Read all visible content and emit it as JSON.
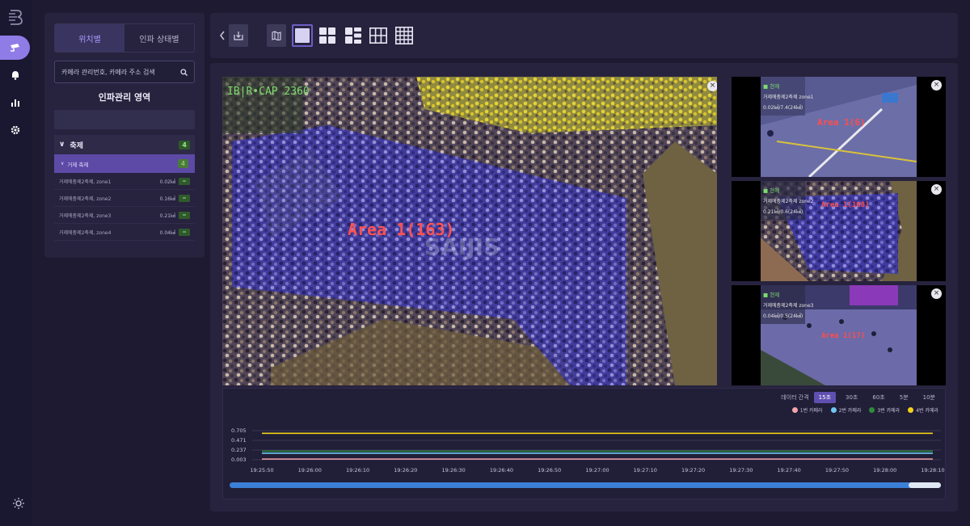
{
  "sidebar": {
    "tabs": [
      "위치별",
      "인파 상태별"
    ],
    "active_tab": 0,
    "search_placeholder": "카메라 관리번호, 카메라 주소 검색",
    "section_title": "인파관리 영역",
    "group": {
      "label": "축제",
      "count": "4"
    },
    "subgroup": {
      "label": "거제 축제",
      "count": "4"
    },
    "items": [
      {
        "name": "거제에충제2축제, zone1",
        "area": "0.02㎢"
      },
      {
        "name": "거제에충제2축제, zone2",
        "area": "0.16㎢"
      },
      {
        "name": "거제에충제2축제, zone3",
        "area": "0.21㎢"
      },
      {
        "name": "거제에충제2축제, zone4",
        "area": "0.04㎢"
      }
    ]
  },
  "toolbar": {
    "layouts": [
      "1x1",
      "2x2",
      "1+3",
      "3x3",
      "4x4"
    ],
    "selected_layout": "1x1"
  },
  "videos": {
    "main": {
      "area_label": "Area 1(163)",
      "overlay_id": "IB|R•CAP 2360",
      "watermark": "SAIJIS"
    },
    "side": [
      {
        "area_label": "Area 1(6)",
        "cam_tag": "■ 현재",
        "cam_name": "거제에충제2축제 zone1",
        "metric": "0.02㎢/7.4(24㎢)"
      },
      {
        "area_label": "Area 1(108)",
        "cam_tag": "■ 현재",
        "cam_name": "거제에충제2축제 zone2",
        "metric": "0.21㎢/0.6(24㎢)"
      },
      {
        "area_label": "Area 1(17)",
        "cam_tag": "■ 현재",
        "cam_name": "거제에충제2축제 zone3",
        "metric": "0.04㎢/0.5(24㎢)"
      }
    ]
  },
  "interval": {
    "label": "데이터 간격",
    "options": [
      "15초",
      "30초",
      "60초",
      "5분",
      "10분"
    ],
    "active": "15초"
  },
  "colors": {
    "accent": "#8f7ce6",
    "cam1": "#f4a3a8",
    "cam2": "#6ec8f0",
    "cam3": "#2e8b3c",
    "cam4": "#f2d21b"
  },
  "chart_data": {
    "type": "line",
    "ylabel": "",
    "yticks": [
      "0.705",
      "0.471",
      "0.237",
      "0.003"
    ],
    "ylim": [
      0.003,
      0.705
    ],
    "x": [
      "19:25:50",
      "19:26:00",
      "19:26:10",
      "19:26:20",
      "19:26:30",
      "19:26:40",
      "19:26:50",
      "19:27:00",
      "19:27:10",
      "19:27:20",
      "19:27:30",
      "19:27:40",
      "19:27:50",
      "19:28:00",
      "19:28:10"
    ],
    "series": [
      {
        "name": "1번 카메라",
        "color": "#f4a3a8",
        "values": [
          0.02,
          0.02,
          0.02,
          0.02,
          0.02,
          0.02,
          0.02,
          0.02,
          0.02,
          0.02,
          0.02,
          0.02,
          0.02,
          0.02,
          0.02
        ]
      },
      {
        "name": "2번 카메라",
        "color": "#6ec8f0",
        "values": [
          0.16,
          0.16,
          0.16,
          0.16,
          0.16,
          0.16,
          0.16,
          0.16,
          0.16,
          0.16,
          0.16,
          0.16,
          0.16,
          0.16,
          0.16
        ]
      },
      {
        "name": "3번 카메라",
        "color": "#2e8b3c",
        "values": [
          0.21,
          0.21,
          0.21,
          0.21,
          0.21,
          0.21,
          0.21,
          0.21,
          0.21,
          0.21,
          0.21,
          0.21,
          0.21,
          0.21,
          0.21
        ]
      },
      {
        "name": "4번 카메라",
        "color": "#f2d21b",
        "values": [
          0.64,
          0.64,
          0.64,
          0.64,
          0.64,
          0.64,
          0.64,
          0.64,
          0.64,
          0.64,
          0.64,
          0.64,
          0.64,
          0.64,
          0.64
        ]
      }
    ]
  }
}
